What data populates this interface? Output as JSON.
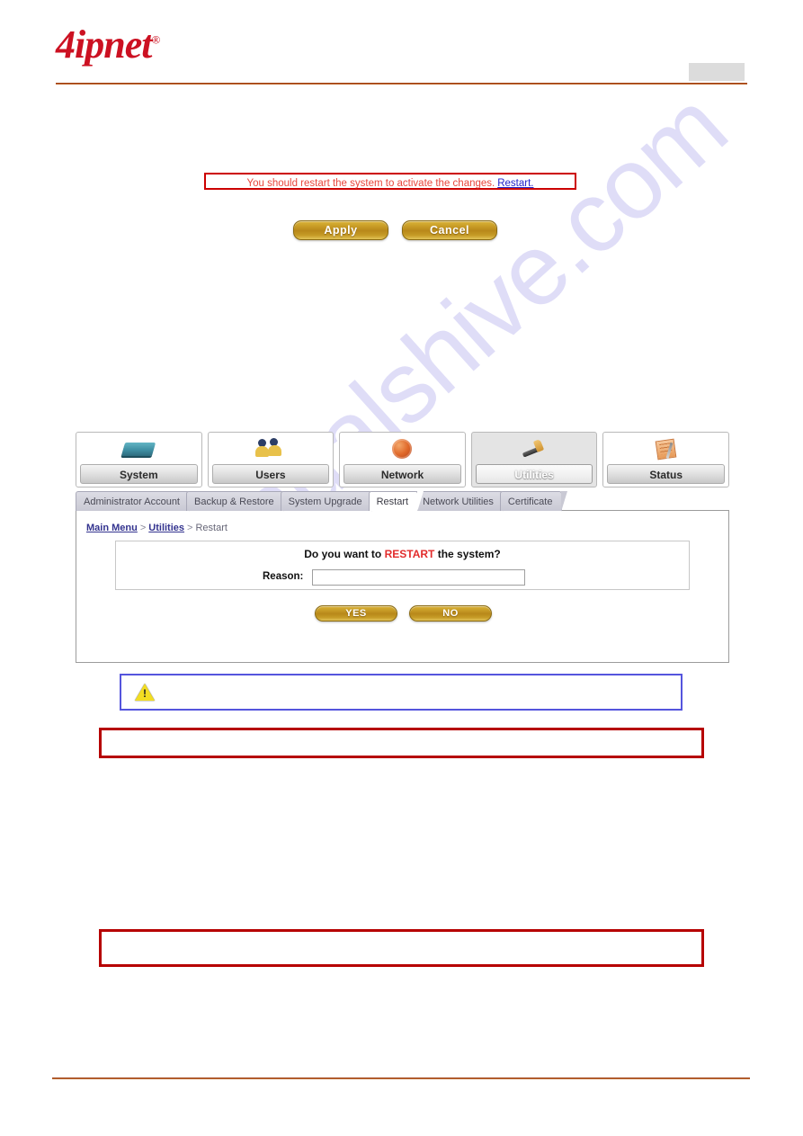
{
  "header": {
    "logo_text": "4ipnet",
    "logo_registered": "®",
    "blank_box": ""
  },
  "restart_notice": {
    "message": "You should restart the system to activate the changes.",
    "link_label": "Restart.",
    "text_color": "#e8463c",
    "link_color": "#2222cc",
    "border_color": "#cc0000"
  },
  "form_actions": {
    "apply_label": "Apply",
    "cancel_label": "Cancel",
    "button_color": "#b8881a"
  },
  "main_nav": {
    "tiles": [
      {
        "label": "System",
        "icon": "network-device-icon",
        "active": false
      },
      {
        "label": "Users",
        "icon": "users-icon",
        "active": false
      },
      {
        "label": "Network",
        "icon": "globe-icon",
        "active": false
      },
      {
        "label": "Utilities",
        "icon": "hammer-icon",
        "active": true
      },
      {
        "label": "Status",
        "icon": "notepad-icon",
        "active": false
      }
    ]
  },
  "sub_tabs": {
    "items": [
      {
        "label": "Administrator Account",
        "active": false
      },
      {
        "label": "Backup & Restore",
        "active": false
      },
      {
        "label": "System Upgrade",
        "active": false
      },
      {
        "label": "Restart",
        "active": true
      },
      {
        "label": "Network Utilities",
        "active": false
      },
      {
        "label": "Certificate",
        "active": false
      }
    ]
  },
  "breadcrumb": {
    "main_menu": "Main Menu",
    "separator_1": ">",
    "utilities": "Utilities",
    "separator_2": ">",
    "current": "Restart"
  },
  "restart_dialog": {
    "question_prefix": "Do you want to ",
    "question_highlight": "RESTART",
    "question_suffix": " the system?",
    "highlight_color": "#e22c2c",
    "reason_label": "Reason:",
    "reason_value": "",
    "reason_placeholder": "",
    "yes_label": "YES",
    "no_label": "NO"
  },
  "callouts": {
    "warning_box": {
      "icon": "warning-triangle-icon",
      "text": "",
      "border_color": "#5555dd"
    },
    "note_box_1": {
      "text": "",
      "border_color": "#b60000"
    },
    "note_box_2": {
      "text": "",
      "border_color": "#b60000"
    }
  },
  "watermark": {
    "text": "manualshive.com",
    "color": "#b9b6ee"
  }
}
